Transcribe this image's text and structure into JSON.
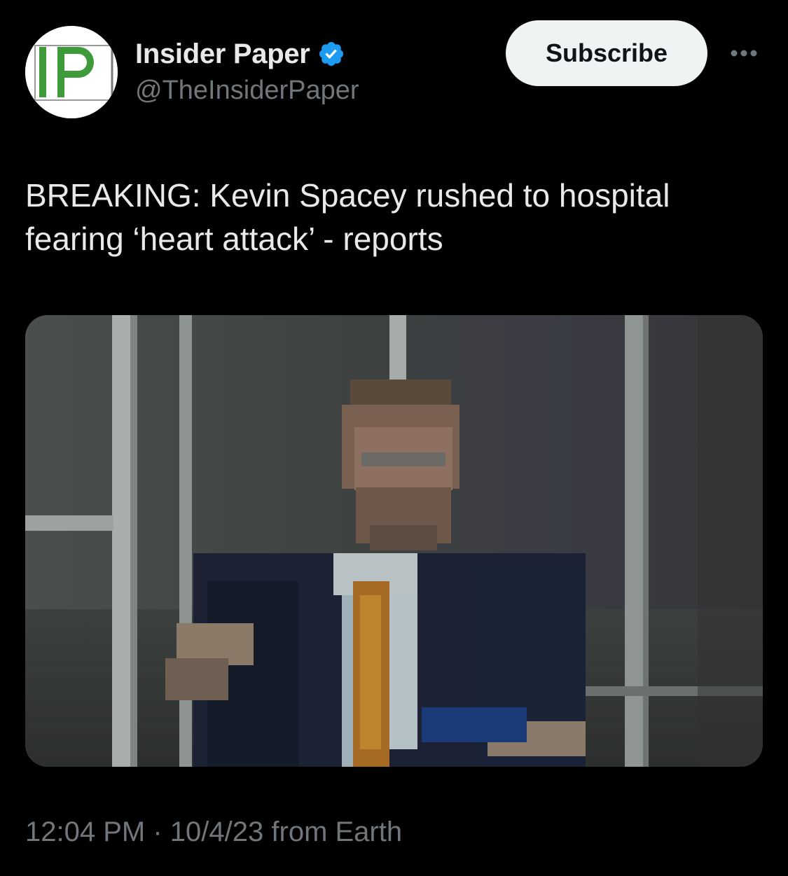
{
  "account": {
    "display_name": "Insider Paper",
    "handle": "@TheInsiderPaper",
    "verified": true,
    "avatar_text": "IP",
    "avatar_colors": {
      "background": "#ffffff",
      "letter": "#3f9a3a",
      "frame": "#9a9a9a"
    }
  },
  "actions": {
    "subscribe_label": "Subscribe",
    "more_icon": "more-horizontal-icon"
  },
  "tweet": {
    "text": "BREAKING: Kevin Spacey rushed to hospital fearing ‘heart attack’ - reports",
    "media_description_icon": "photo"
  },
  "meta": {
    "time": "12:04 PM",
    "separator": "·",
    "date": "10/4/23",
    "location": "from Earth"
  },
  "colors": {
    "background": "#000000",
    "text_primary": "#e7e9ea",
    "text_secondary": "#71767b",
    "verified_badge": "#1d9bf0",
    "button_bg": "#eff3f4",
    "button_text": "#0f1419"
  }
}
